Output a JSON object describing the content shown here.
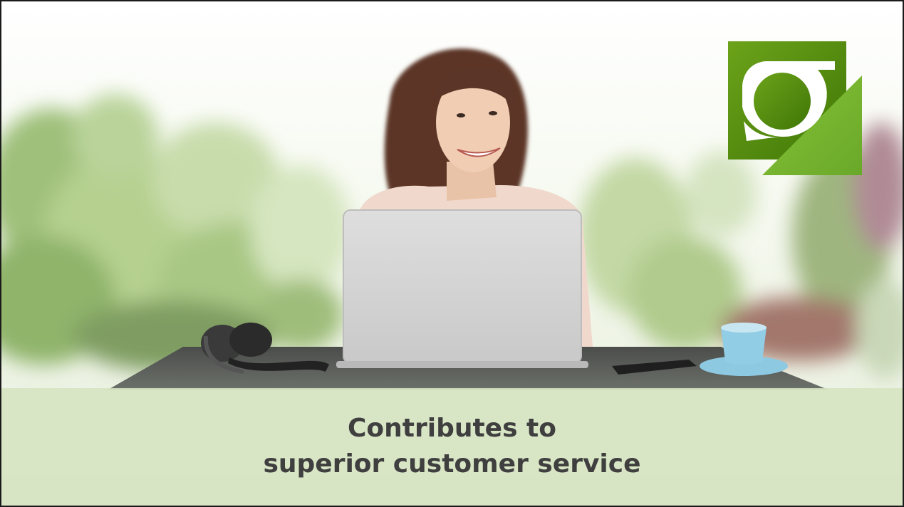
{
  "caption": {
    "line1": "Contributes to",
    "line2": "superior customer service"
  },
  "colors": {
    "logo_dark_green": "#4f8a0b",
    "logo_light_green": "#7ab62c",
    "caption_band": "#d6e4c2",
    "caption_text": "#3f3f3f"
  },
  "icons": {
    "logo": "green-square-logo-icon"
  }
}
